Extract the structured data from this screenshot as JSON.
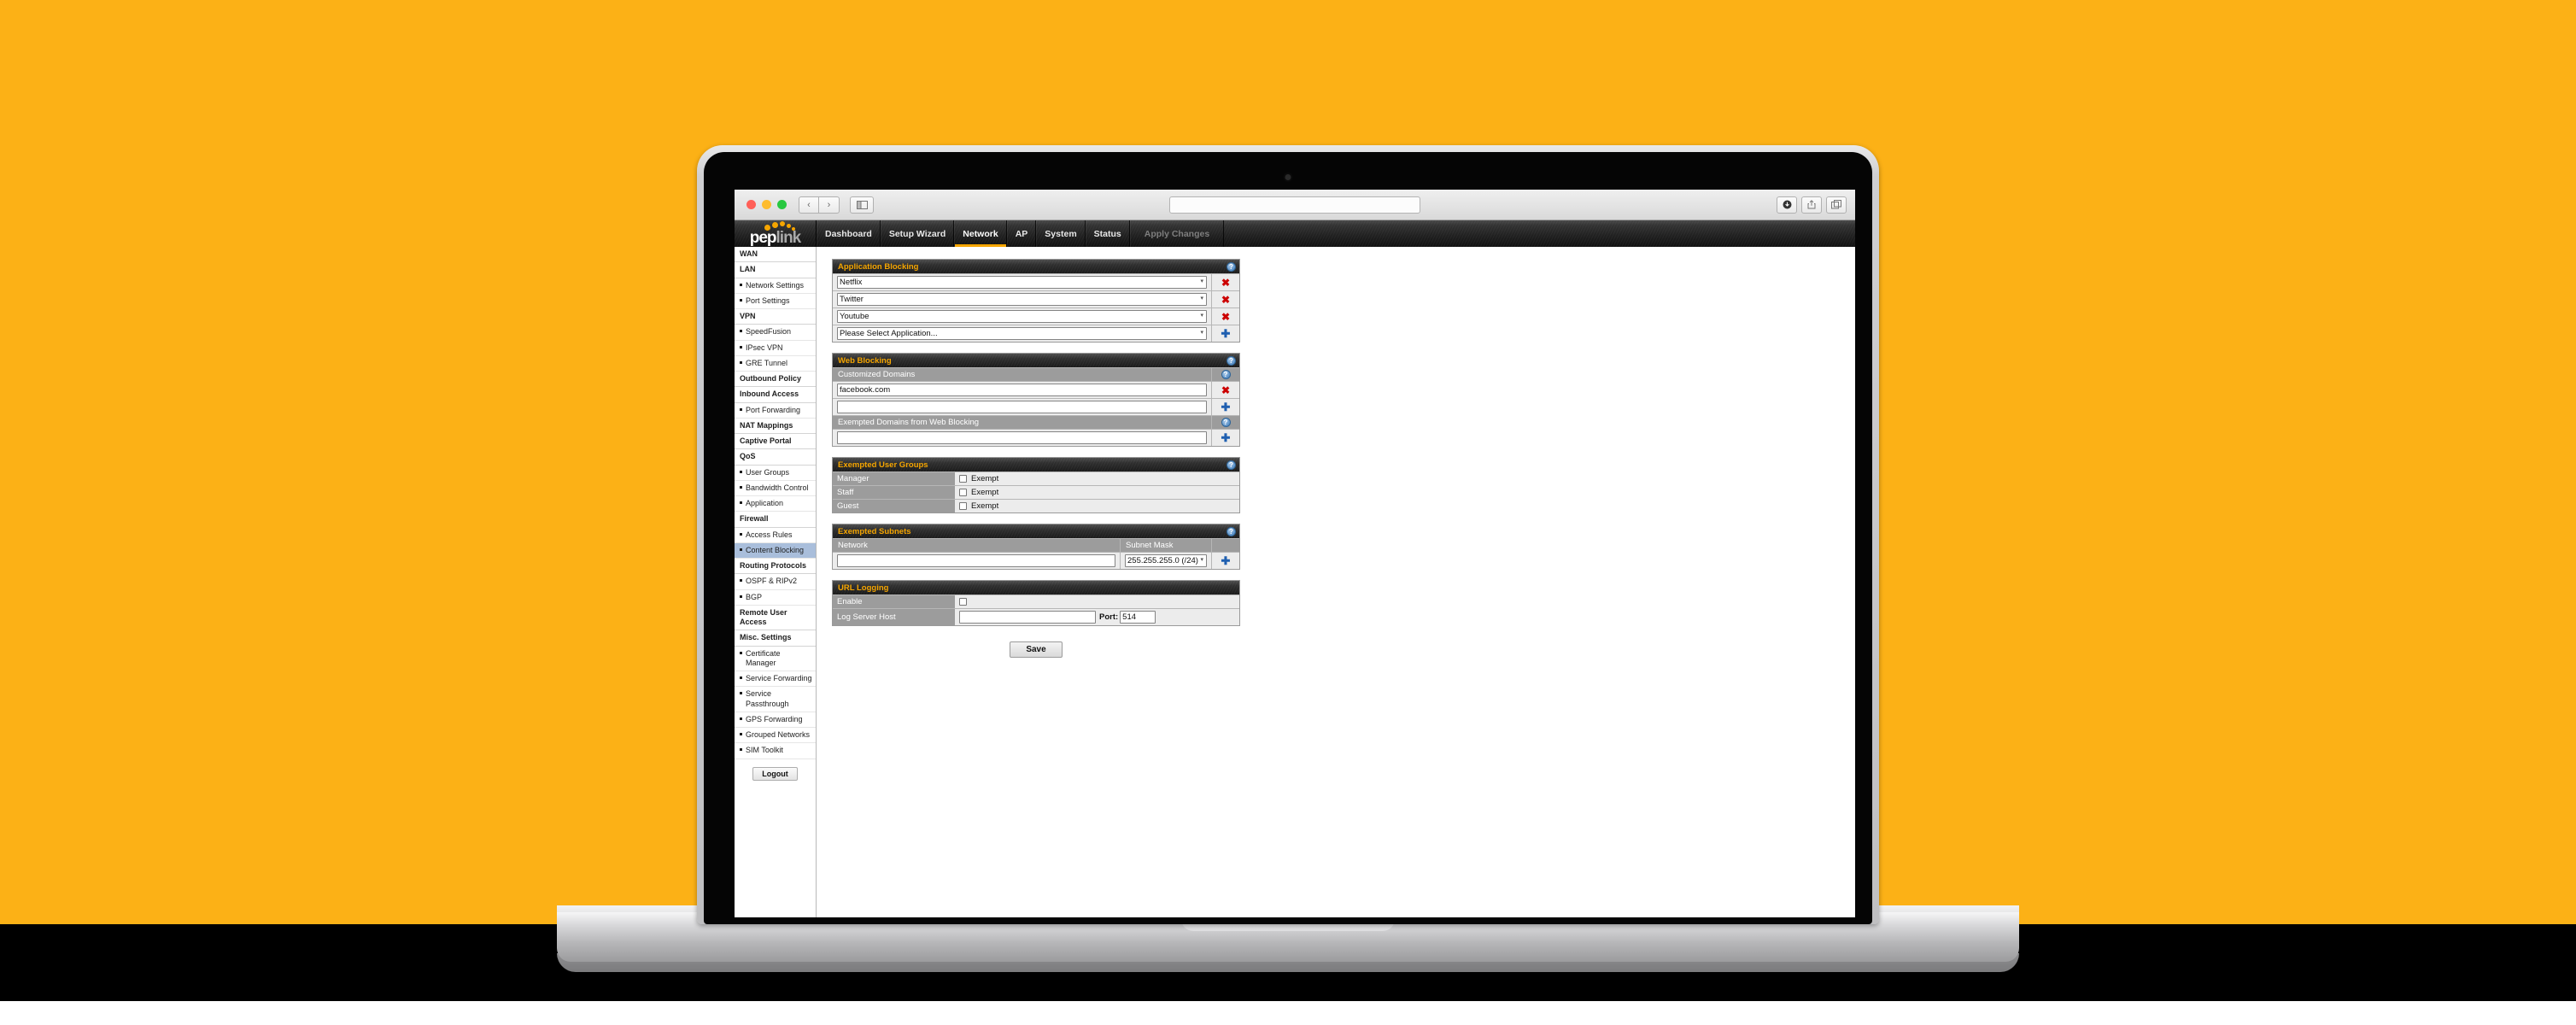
{
  "theme": {
    "background": "#fcb116",
    "accent": "#f5a500",
    "panel_header_text": "#f5a500",
    "selected_sidebar": "#a9bedb",
    "delete_icon_color": "#cc0000",
    "add_icon_color": "#1f5fb0"
  },
  "browser": {
    "traffic_lights": [
      "close-red",
      "minimize-yellow",
      "maximize-green"
    ],
    "back_label": "‹",
    "forward_label": "›",
    "sidebar_toggle_icon": "sidebar-icon",
    "url_value": "",
    "url_placeholder": "",
    "right_buttons": [
      "downloads-icon",
      "share-icon",
      "tabs-icon"
    ]
  },
  "header": {
    "logo_text_1": "pep",
    "logo_text_2": "link",
    "nav": [
      {
        "label": "Dashboard",
        "active": false
      },
      {
        "label": "Setup Wizard",
        "active": false
      },
      {
        "label": "Network",
        "active": true
      },
      {
        "label": "AP",
        "active": false
      },
      {
        "label": "System",
        "active": false
      },
      {
        "label": "Status",
        "active": false
      }
    ],
    "apply_changes": "Apply Changes"
  },
  "sidebar": {
    "items": [
      {
        "label": "WAN",
        "type": "group",
        "selected": false
      },
      {
        "label": "LAN",
        "type": "group",
        "selected": false
      },
      {
        "label": "Network Settings",
        "type": "item",
        "selected": false
      },
      {
        "label": "Port Settings",
        "type": "item",
        "selected": false
      },
      {
        "label": "VPN",
        "type": "group",
        "selected": false
      },
      {
        "label": "SpeedFusion",
        "type": "item",
        "selected": false
      },
      {
        "label": "IPsec VPN",
        "type": "item",
        "selected": false
      },
      {
        "label": "GRE Tunnel",
        "type": "item",
        "selected": false
      },
      {
        "label": "Outbound Policy",
        "type": "group",
        "selected": false
      },
      {
        "label": "Inbound Access",
        "type": "group",
        "selected": false
      },
      {
        "label": "Port Forwarding",
        "type": "item",
        "selected": false
      },
      {
        "label": "NAT Mappings",
        "type": "group",
        "selected": false
      },
      {
        "label": "Captive Portal",
        "type": "group",
        "selected": false
      },
      {
        "label": "QoS",
        "type": "group",
        "selected": false
      },
      {
        "label": "User Groups",
        "type": "item",
        "selected": false
      },
      {
        "label": "Bandwidth Control",
        "type": "item",
        "selected": false
      },
      {
        "label": "Application",
        "type": "item",
        "selected": false
      },
      {
        "label": "Firewall",
        "type": "group",
        "selected": false
      },
      {
        "label": "Access Rules",
        "type": "item",
        "selected": false
      },
      {
        "label": "Content Blocking",
        "type": "item",
        "selected": true
      },
      {
        "label": "Routing Protocols",
        "type": "group",
        "selected": false
      },
      {
        "label": "OSPF & RIPv2",
        "type": "item",
        "selected": false
      },
      {
        "label": "BGP",
        "type": "item",
        "selected": false
      },
      {
        "label": "Remote User Access",
        "type": "group",
        "selected": false
      },
      {
        "label": "Misc. Settings",
        "type": "group",
        "selected": false
      },
      {
        "label": "Certificate Manager",
        "type": "item",
        "selected": false
      },
      {
        "label": "Service Forwarding",
        "type": "item",
        "selected": false
      },
      {
        "label": "Service Passthrough",
        "type": "item",
        "selected": false
      },
      {
        "label": "GPS Forwarding",
        "type": "item",
        "selected": false
      },
      {
        "label": "Grouped Networks",
        "type": "item",
        "selected": false
      },
      {
        "label": "SIM Toolkit",
        "type": "item",
        "selected": false
      }
    ],
    "logout_label": "Logout"
  },
  "application_blocking": {
    "title": "Application Blocking",
    "help_icon": "help-icon",
    "rows": [
      {
        "value": "Netflix",
        "action": "remove"
      },
      {
        "value": "Twitter",
        "action": "remove"
      },
      {
        "value": "Youtube",
        "action": "remove"
      },
      {
        "value": "Please Select Application...",
        "action": "add"
      }
    ]
  },
  "web_blocking": {
    "title": "Web Blocking",
    "customized_domains_label": "Customized Domains",
    "exempted_domains_label": "Exempted Domains from Web Blocking",
    "customized_domains": [
      {
        "value": "",
        "placeholder": "",
        "display": "facebook.com",
        "action": "remove"
      },
      {
        "value": "",
        "placeholder": "",
        "display": "",
        "action": "add"
      }
    ],
    "exempted_domains": [
      {
        "value": "",
        "placeholder": "",
        "display": "",
        "action": "add"
      }
    ]
  },
  "exempted_user_groups": {
    "title": "Exempted User Groups",
    "exempt_label": "Exempt",
    "groups": [
      {
        "name": "Manager",
        "checked": false
      },
      {
        "name": "Staff",
        "checked": false
      },
      {
        "name": "Guest",
        "checked": false
      }
    ]
  },
  "exempted_subnets": {
    "title": "Exempted Subnets",
    "network_header": "Network",
    "subnet_mask_header": "Subnet Mask",
    "network_value": "",
    "subnet_mask_value": "255.255.255.0 (/24)",
    "action": "add"
  },
  "url_logging": {
    "title": "URL Logging",
    "enable_label": "Enable",
    "enable_checked": false,
    "log_server_host_label": "Log Server Host",
    "log_server_host_value": "",
    "port_label": "Port:",
    "port_value": "514"
  },
  "footer": {
    "save_label": "Save"
  }
}
